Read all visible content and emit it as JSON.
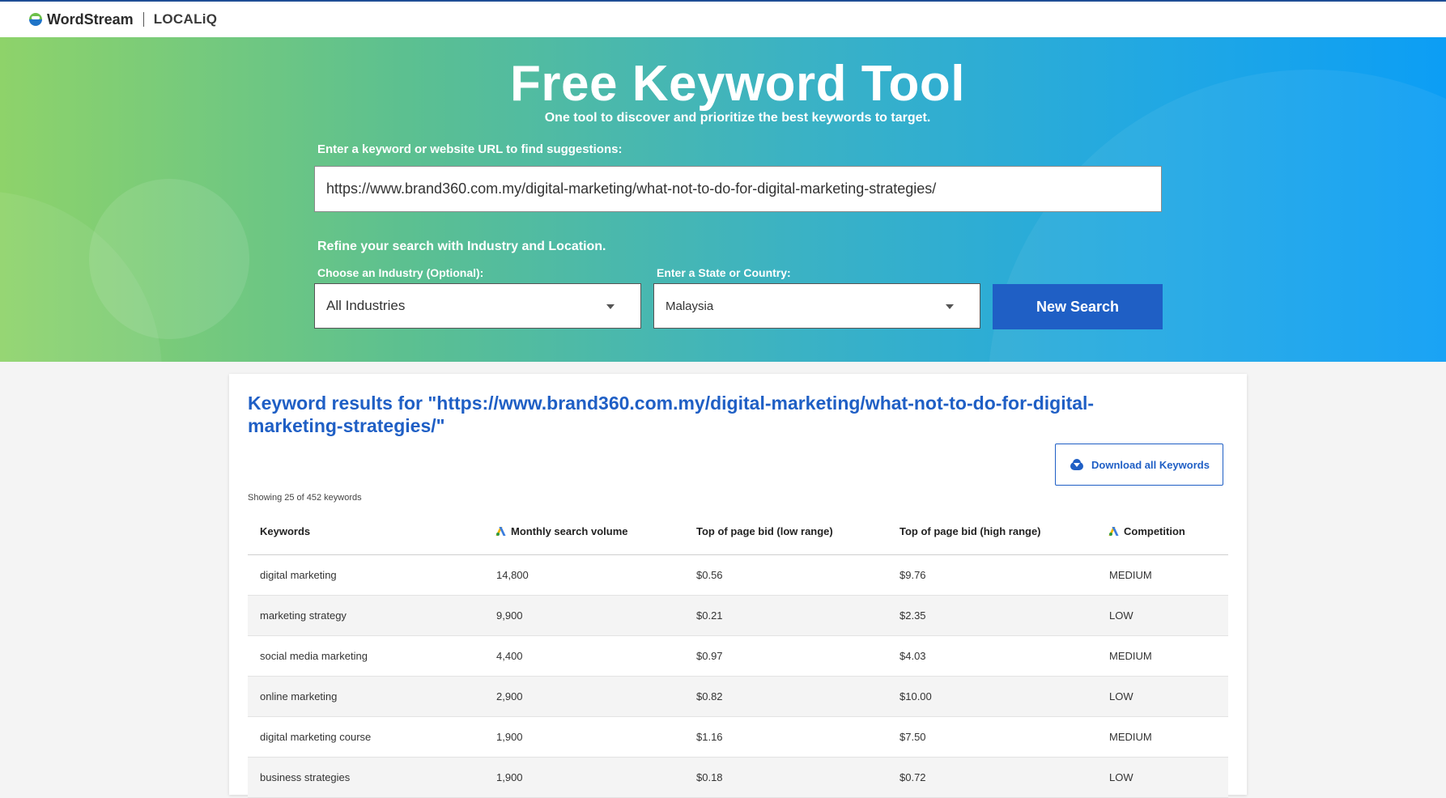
{
  "brand": {
    "primary": "WordStream",
    "secondary": "LOCALiQ"
  },
  "hero": {
    "title": "Free Keyword Tool",
    "subtitle": "One tool to discover and prioritize the best keywords to target.",
    "search_label": "Enter a keyword or website URL to find suggestions:",
    "search_value": "https://www.brand360.com.my/digital-marketing/what-not-to-do-for-digital-marketing-strategies/",
    "refine_label": "Refine your search with Industry and Location.",
    "industry_label": "Choose an Industry (Optional):",
    "industry_value": "All Industries",
    "location_label": "Enter a State or Country:",
    "location_value": "Malaysia",
    "search_button": "New Search"
  },
  "results": {
    "title": "Keyword results for \"https://www.brand360.com.my/digital-marketing/what-not-to-do-for-digital-marketing-strategies/\"",
    "download_button": "Download all Keywords",
    "showing": "Showing 25 of 452 keywords",
    "columns": {
      "keywords": "Keywords",
      "volume": "Monthly search volume",
      "bid_low": "Top of page bid (low range)",
      "bid_high": "Top of page bid (high range)",
      "competition": "Competition"
    },
    "rows": [
      {
        "keyword": "digital marketing",
        "volume": "14,800",
        "low": "$0.56",
        "high": "$9.76",
        "competition": "MEDIUM"
      },
      {
        "keyword": "marketing strategy",
        "volume": "9,900",
        "low": "$0.21",
        "high": "$2.35",
        "competition": "LOW"
      },
      {
        "keyword": "social media marketing",
        "volume": "4,400",
        "low": "$0.97",
        "high": "$4.03",
        "competition": "MEDIUM"
      },
      {
        "keyword": "online marketing",
        "volume": "2,900",
        "low": "$0.82",
        "high": "$10.00",
        "competition": "LOW"
      },
      {
        "keyword": "digital marketing course",
        "volume": "1,900",
        "low": "$1.16",
        "high": "$7.50",
        "competition": "MEDIUM"
      },
      {
        "keyword": "business strategies",
        "volume": "1,900",
        "low": "$0.18",
        "high": "$0.72",
        "competition": "LOW"
      }
    ]
  },
  "icons": {
    "logo": "wordstream-logo-icon",
    "dropdown": "caret-down-icon",
    "download": "cloud-download-icon",
    "google_ads": "google-ads-icon"
  },
  "colors": {
    "accent": "#1f5fc5",
    "gradient_start": "#8ed36a",
    "gradient_end": "#0c9ef5"
  }
}
